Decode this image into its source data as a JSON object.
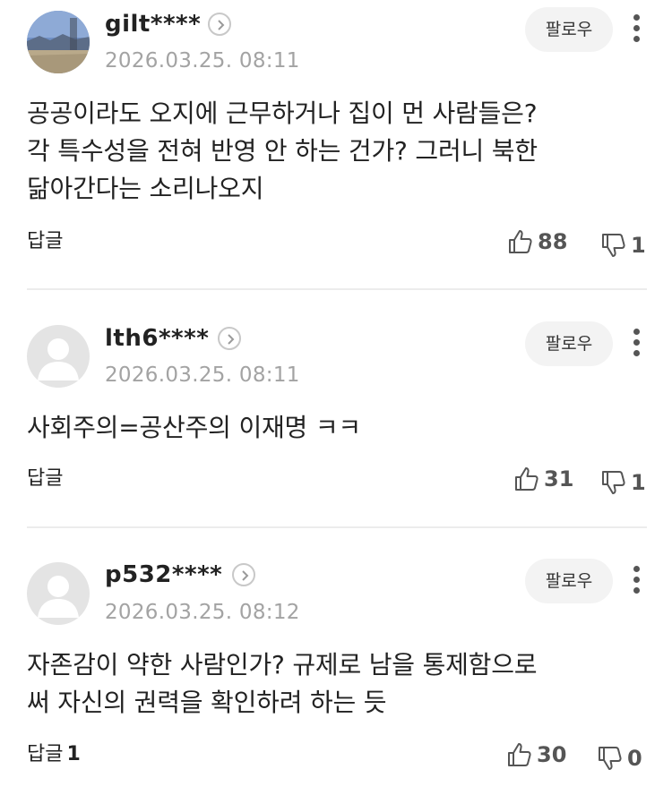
{
  "follow_label": "팔로우",
  "reply_label": "답글",
  "comments": [
    {
      "username": "gilt****",
      "timestamp": "2026.03.25. 08:11",
      "avatar": "landscape-photo",
      "text": "공공이라도 오지에 근무하거나 집이 먼 사람들은?\n각 특수성을 전혀 반영 안 하는 건가? 그러니 북한\n닮아간다는 소리나오지",
      "reply_count": "",
      "likes": "88",
      "dislikes": "1"
    },
    {
      "username": "lth6****",
      "timestamp": "2026.03.25. 08:11",
      "avatar": "default-user",
      "text": "사회주의=공산주의 이재명 ㅋㅋ",
      "reply_count": "",
      "likes": "31",
      "dislikes": "1"
    },
    {
      "username": "p532****",
      "timestamp": "2026.03.25. 08:12",
      "avatar": "default-user",
      "text": "자존감이 약한 사람인가? 규제로 남을 통제함으로\n써 자신의 권력을 확인하려 하는 듯",
      "reply_count": "1",
      "likes": "30",
      "dislikes": "0"
    }
  ]
}
